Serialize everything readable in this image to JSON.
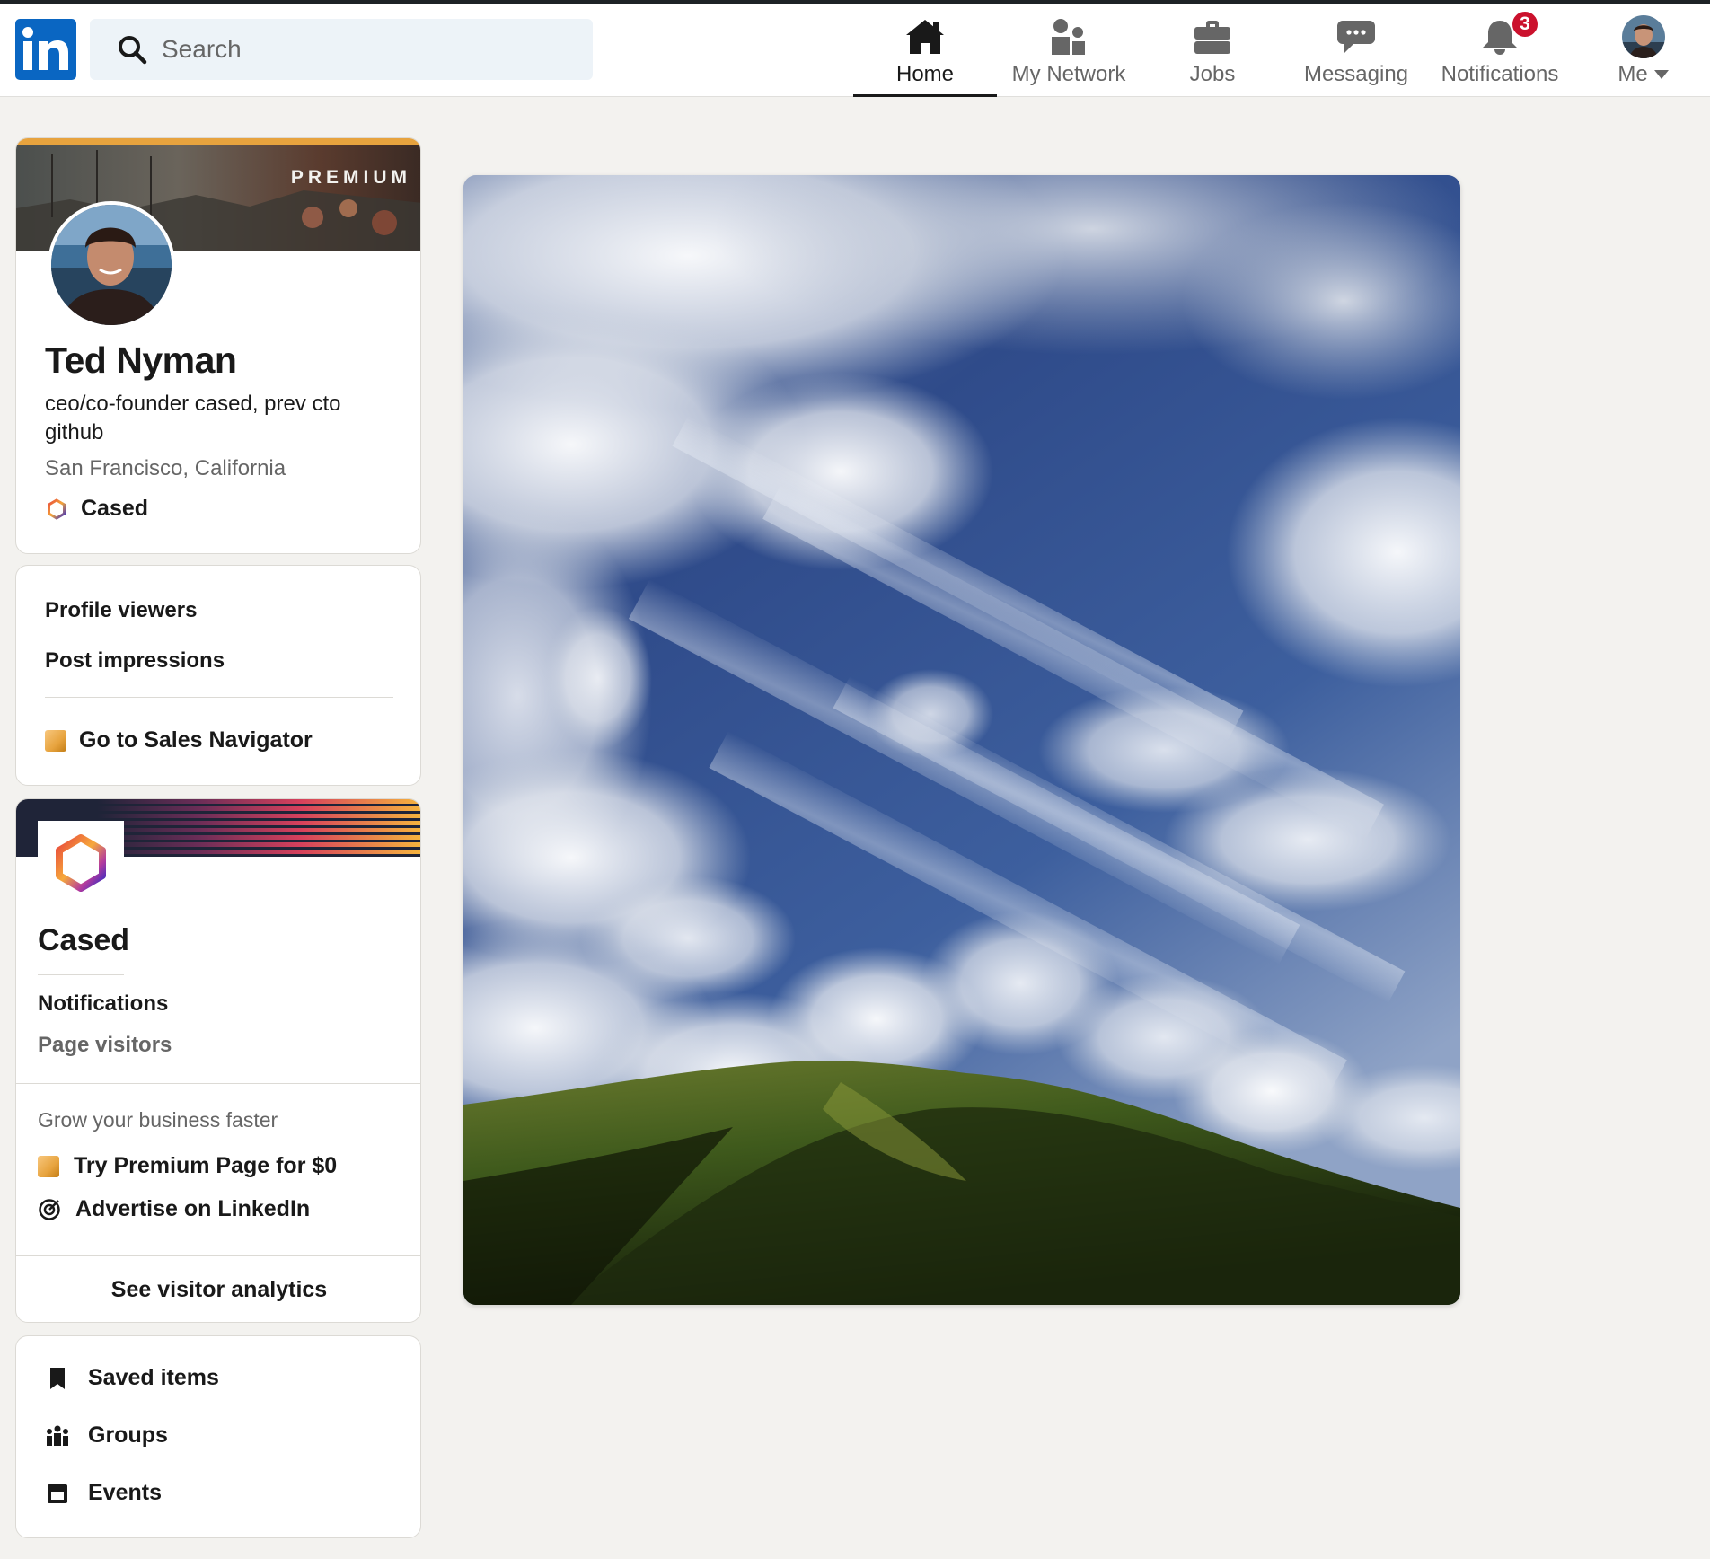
{
  "brand": {
    "logo_text": "in",
    "color": "#0a66c2"
  },
  "search": {
    "placeholder": "Search",
    "icon": "search-icon"
  },
  "nav": {
    "home": {
      "label": "Home",
      "icon": "home-icon"
    },
    "network": {
      "label": "My Network",
      "icon": "network-icon"
    },
    "jobs": {
      "label": "Jobs",
      "icon": "briefcase-icon"
    },
    "messaging": {
      "label": "Messaging",
      "icon": "chat-icon"
    },
    "notifications": {
      "label": "Notifications",
      "icon": "bell-icon",
      "badge": "3"
    },
    "me": {
      "label": "Me",
      "icon": "chevron-down-icon"
    }
  },
  "profile": {
    "premium_label": "PREMIUM",
    "name": "Ted Nyman",
    "headline": "ceo/co-founder cased, prev cto github",
    "location": "San Francisco, California",
    "company": "Cased"
  },
  "stats": {
    "profile_viewers": "Profile viewers",
    "post_impressions": "Post impressions",
    "sales_navigator": "Go to Sales Navigator"
  },
  "page": {
    "name": "Cased",
    "notifications": "Notifications",
    "page_visitors": "Page visitors",
    "grow_text": "Grow your business faster",
    "premium_page": "Try Premium Page for $0",
    "advertise": "Advertise on LinkedIn",
    "analytics": "See visitor analytics"
  },
  "quick_links": {
    "saved": "Saved items",
    "groups": "Groups",
    "events": "Events"
  },
  "colors": {
    "background": "#f3f2ef",
    "premium_gold": "#e7a33e",
    "badge_red": "#cb112d",
    "brand_blue": "#0a66c2"
  }
}
